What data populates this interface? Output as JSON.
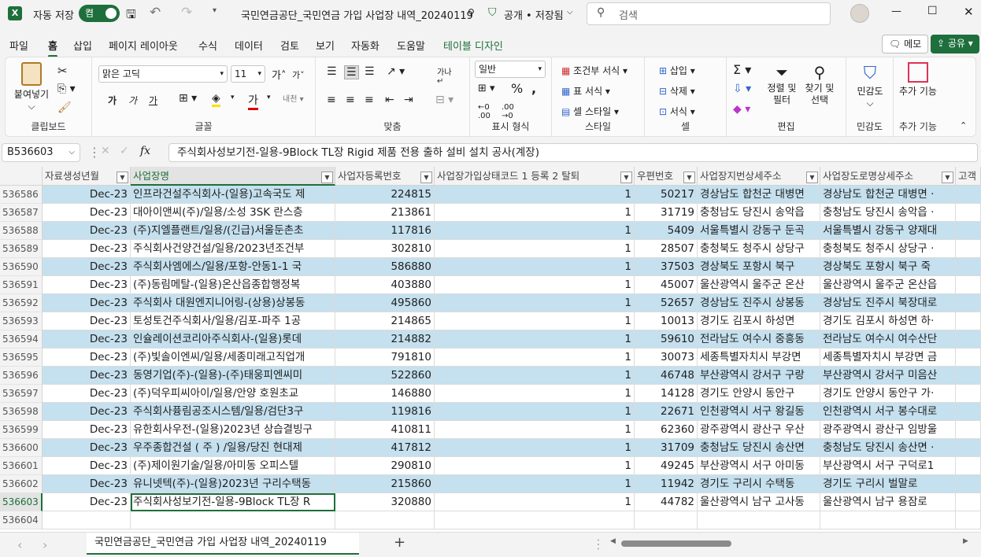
{
  "titlebar": {
    "autosave_label": "자동 저장",
    "autosave_state": "켬",
    "doc_title": "국민연금공단_국민연금 가입 사업장 내역_20240119",
    "share_status": "공개 • 저장됨",
    "search_placeholder": "검색"
  },
  "menu": {
    "items": [
      "파일",
      "홈",
      "삽입",
      "페이지 레이아웃",
      "수식",
      "데이터",
      "검토",
      "보기",
      "자동화",
      "도움말",
      "테이블 디자인"
    ],
    "active": "홈",
    "memo": "메모",
    "share": "공유"
  },
  "ribbon": {
    "clipboard": {
      "paste": "붙여넣기",
      "label": "클립보드"
    },
    "font": {
      "name": "맑은 고딕",
      "size": "11",
      "label": "글꼴",
      "b": "가",
      "i": "가",
      "u": "가"
    },
    "align": {
      "label": "맞춤"
    },
    "number": {
      "format": "일반",
      "label": "표시 형식"
    },
    "styles": {
      "cond": "조건부 서식",
      "table": "표 서식",
      "cell": "셀 스타일",
      "label": "스타일"
    },
    "cells": {
      "insert": "삽입",
      "delete": "삭제",
      "format": "서식",
      "label": "셀"
    },
    "editing": {
      "sort": "정렬 및 필터",
      "find": "찾기 및 선택",
      "label": "편집"
    },
    "sensitivity": {
      "btn": "민감도",
      "label": "민감도"
    },
    "addins": {
      "btn": "추가 기능",
      "label": "추가 기능"
    }
  },
  "formula": {
    "namebox": "B536603",
    "fx": "fx",
    "content": "주식회사성보기전-일용-9Block TL장 Rigid 제품 전용 출하 설비 설치 공사(계장)"
  },
  "grid": {
    "headers": [
      "자료생성년월",
      "사업장명",
      "사업자등록번호",
      "사업장가입상태코드 1 등록 2 탈퇴",
      "우편번호",
      "사업장지번상세주소",
      "사업장도로명상세주소",
      "고객"
    ],
    "rows": [
      {
        "n": "536586",
        "a": "Dec-23",
        "b": "인프라건설주식회사-(일용)고속국도 제",
        "c": "224815",
        "d": "1",
        "e": "50217",
        "f": "경상남도 합천군 대병면",
        "g": "경상남도 합천군 대병면 ·"
      },
      {
        "n": "536587",
        "a": "Dec-23",
        "b": "대아이앤씨(주)/일용/소성 3SK 란스층",
        "c": "213861",
        "d": "1",
        "e": "31719",
        "f": "충청남도 당진시 송악읍",
        "g": "충청남도 당진시 송악읍 ·"
      },
      {
        "n": "536588",
        "a": "Dec-23",
        "b": "(주)지엘플랜트/일용/(긴급)서울둔촌초",
        "c": "117816",
        "d": "1",
        "e": "5409",
        "f": "서울특별시 강동구 둔곡",
        "g": "서울특별시 강동구 양재대"
      },
      {
        "n": "536589",
        "a": "Dec-23",
        "b": "주식회사건양건설/일용/2023년조건부",
        "c": "302810",
        "d": "1",
        "e": "28507",
        "f": "충청북도 청주시 상당구",
        "g": "충청북도 청주시 상당구 ·"
      },
      {
        "n": "536590",
        "a": "Dec-23",
        "b": "주식회사엠에스/일용/포항-안동1-1 국",
        "c": "586880",
        "d": "1",
        "e": "37503",
        "f": "경상북도 포항시 북구",
        "g": "경상북도 포항시 북구 죽"
      },
      {
        "n": "536591",
        "a": "Dec-23",
        "b": "(주)동림메탈-(일용)온산읍종합행정복",
        "c": "403880",
        "d": "1",
        "e": "45007",
        "f": "울산광역시 울주군 온산",
        "g": "울산광역시 울주군 온산읍"
      },
      {
        "n": "536592",
        "a": "Dec-23",
        "b": "주식회사 대원엔지니어링-(상용)상봉동",
        "c": "495860",
        "d": "1",
        "e": "52657",
        "f": "경상남도 진주시 상봉동",
        "g": "경상남도 진주시 북장대로"
      },
      {
        "n": "536593",
        "a": "Dec-23",
        "b": "토성토건주식회사/일용/김포-파주 1공",
        "c": "214865",
        "d": "1",
        "e": "10013",
        "f": "경기도 김포시 하성면",
        "g": "경기도 김포시 하성면 하·"
      },
      {
        "n": "536594",
        "a": "Dec-23",
        "b": "인슐레이션코리아주식회사-(일용)롯데",
        "c": "214882",
        "d": "1",
        "e": "59610",
        "f": "전라남도 여수시 중흥동",
        "g": "전라남도 여수시 여수산단"
      },
      {
        "n": "536595",
        "a": "Dec-23",
        "b": "(주)빛솔이엔씨/일용/세종미래고직업개",
        "c": "791810",
        "d": "1",
        "e": "30073",
        "f": "세종특별자치시 부강면",
        "g": "세종특별자치시 부강면 금"
      },
      {
        "n": "536596",
        "a": "Dec-23",
        "b": "동영기업(주)-(일용)-(주)태웅피엔씨미",
        "c": "522860",
        "d": "1",
        "e": "46748",
        "f": "부산광역시 강서구 구랑",
        "g": "부산광역시 강서구 미음산"
      },
      {
        "n": "536597",
        "a": "Dec-23",
        "b": "(주)덕우피씨아이/일용/안양 호원초교",
        "c": "146880",
        "d": "1",
        "e": "14128",
        "f": "경기도 안양시 동안구",
        "g": "경기도 안양시 동안구 가·"
      },
      {
        "n": "536598",
        "a": "Dec-23",
        "b": "주식회사퓽림공조시스템/일용/검단3구",
        "c": "119816",
        "d": "1",
        "e": "22671",
        "f": "인천광역시 서구 왕길동",
        "g": "인천광역시 서구 봉수대로"
      },
      {
        "n": "536599",
        "a": "Dec-23",
        "b": "유한회사우전-(일용)2023년 상습결빙구",
        "c": "410811",
        "d": "1",
        "e": "62360",
        "f": "광주광역시 광산구 우산",
        "g": "광주광역시 광산구 임방울"
      },
      {
        "n": "536600",
        "a": "Dec-23",
        "b": "우주종합건설 ( 주 ) /일용/당진 현대제",
        "c": "417812",
        "d": "1",
        "e": "31709",
        "f": "충청남도 당진시 송산면",
        "g": "충청남도 당진시 송산면 ·"
      },
      {
        "n": "536601",
        "a": "Dec-23",
        "b": "(주)제이원기술/일용/아미동 오피스텔",
        "c": "290810",
        "d": "1",
        "e": "49245",
        "f": "부산광역시 서구 아미동",
        "g": "부산광역시 서구 구덕로1"
      },
      {
        "n": "536602",
        "a": "Dec-23",
        "b": "유니넷텍(주)-(일용)2023년 구리수택동",
        "c": "215860",
        "d": "1",
        "e": "11942",
        "f": "경기도 구리시 수택동",
        "g": "경기도 구리시 벌말로"
      },
      {
        "n": "536603",
        "a": "Dec-23",
        "b": "주식회사성보기전-일용-9Block TL장 R",
        "c": "320880",
        "d": "1",
        "e": "44782",
        "f": "울산광역시 남구 고사동",
        "g": "울산광역시 남구 용잠로"
      },
      {
        "n": "536604",
        "a": "",
        "b": "",
        "c": "",
        "d": "",
        "e": "",
        "f": "",
        "g": ""
      }
    ]
  },
  "sheet": {
    "tab": "국민연금공단_국민연금 가입 사업장 내역_20240119",
    "add": "+"
  },
  "colors": {
    "accent": "#1e6f3c",
    "band": "#c5e0ee"
  }
}
